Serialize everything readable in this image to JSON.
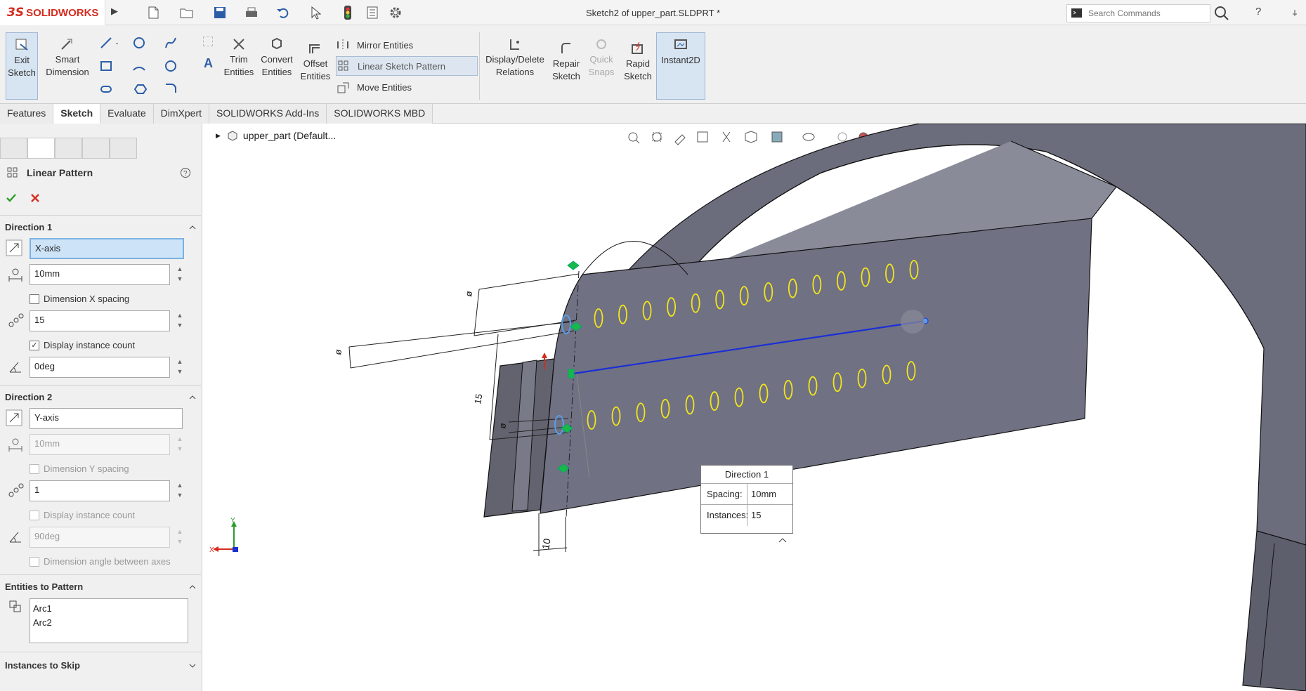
{
  "app": {
    "logo_ds": "3S",
    "logo_text": "SOLIDWORKS",
    "title": "Sketch2 of upper_part.SLDPRT *",
    "search_placeholder": "Search Commands",
    "help_label": "?"
  },
  "toolbar": {
    "exit_sketch": [
      "Exit",
      "Sketch"
    ],
    "smart_dimension": [
      "Smart",
      "Dimension"
    ],
    "trim_entities": [
      "Trim",
      "Entities"
    ],
    "convert_entities": [
      "Convert",
      "Entities"
    ],
    "offset_entities": [
      "Offset",
      "Entities"
    ],
    "mirror_entities": "Mirror Entities",
    "linear_sketch_pattern": "Linear Sketch Pattern",
    "move_entities": "Move Entities",
    "display_delete_relations": [
      "Display/Delete",
      "Relations"
    ],
    "repair_sketch": [
      "Repair",
      "Sketch"
    ],
    "quick_snaps": [
      "Quick",
      "Snaps"
    ],
    "rapid_sketch": [
      "Rapid",
      "Sketch"
    ],
    "instant2d": "Instant2D"
  },
  "tabs": [
    "Features",
    "Sketch",
    "Evaluate",
    "DimXpert",
    "SOLIDWORKS Add-Ins",
    "SOLIDWORKS MBD"
  ],
  "active_tab": "Sketch",
  "property_manager": {
    "title": "Linear Pattern",
    "direction1": {
      "header": "Direction 1",
      "axis": "X-axis",
      "spacing": "10mm",
      "dimension_spacing_label": "Dimension X spacing",
      "dimension_spacing_checked": false,
      "instances": "15",
      "display_instance_count_label": "Display instance count",
      "display_instance_count_checked": true,
      "angle": "0deg"
    },
    "direction2": {
      "header": "Direction 2",
      "axis": "Y-axis",
      "spacing": "10mm",
      "dimension_spacing_label": "Dimension Y spacing",
      "dimension_spacing_checked": false,
      "instances": "1",
      "display_instance_count_label": "Display instance count",
      "display_instance_count_checked": false,
      "angle": "90deg",
      "dimension_angle_label": "Dimension angle between axes"
    },
    "entities_header": "Entities to Pattern",
    "entities": [
      "Arc1",
      "Arc2"
    ],
    "instances_to_skip_header": "Instances to Skip"
  },
  "graphics": {
    "tree_root": "upper_part  (Default...",
    "callout": {
      "title": "Direction 1",
      "spacing_label": "Spacing:",
      "spacing_value": "10mm",
      "instances_label": "Instances:",
      "instances_value": "15"
    },
    "dimension_10": "10",
    "dimension_15": "15",
    "triad_x": "X",
    "triad_y": "Y",
    "colors": {
      "part_face": "#6f7080",
      "part_edge": "#1a1a1a",
      "pattern_arcs": "#f2e61a",
      "direction_line": "#1a2fd6",
      "selection_highlight": "#cde3f7"
    }
  }
}
